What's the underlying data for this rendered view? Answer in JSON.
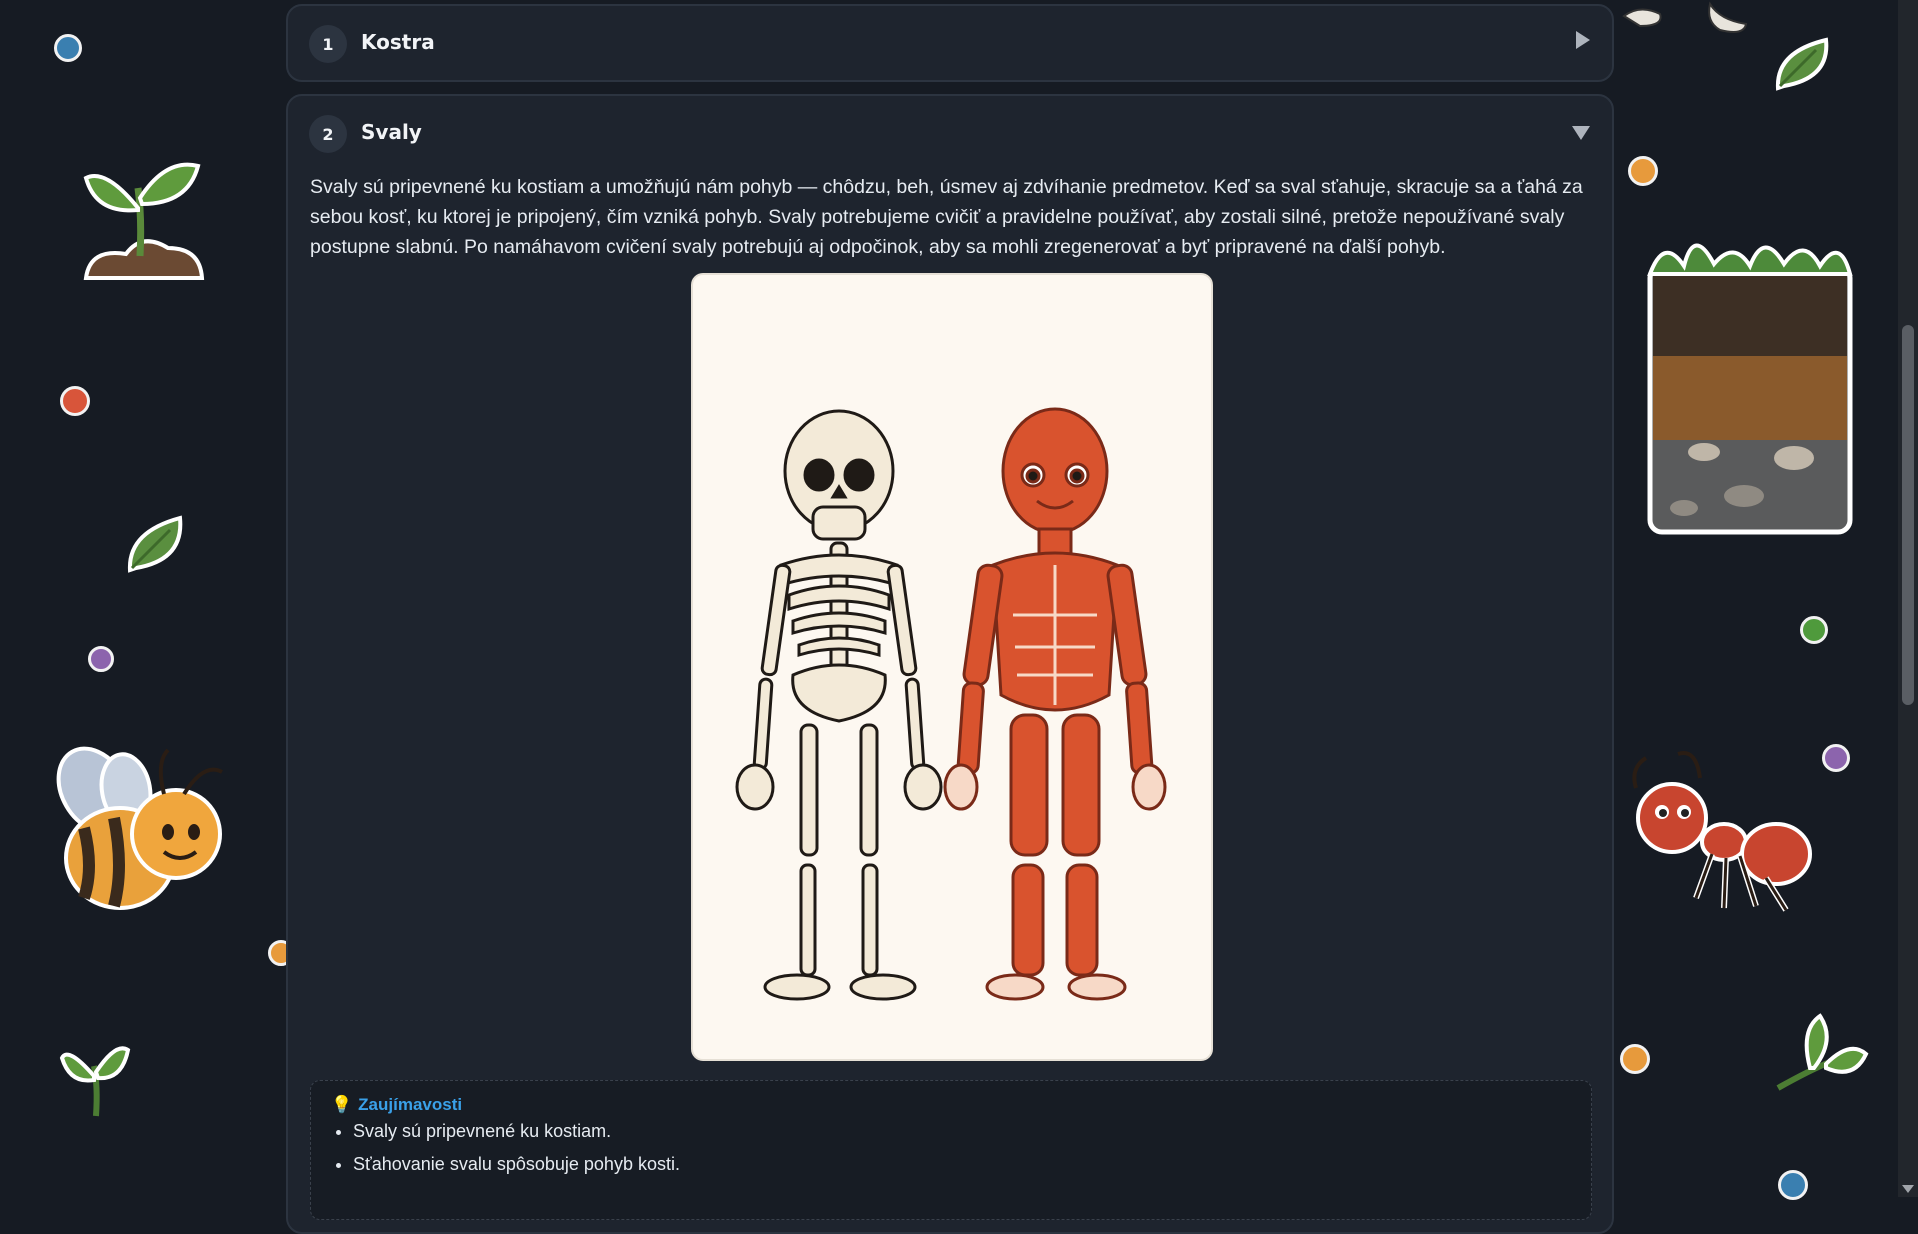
{
  "sections": [
    {
      "number": "1",
      "title": "Kostra",
      "expanded": false
    },
    {
      "number": "2",
      "title": "Svaly",
      "expanded": true,
      "paragraph": "Svaly sú pripevnené ku kostiam a umožňujú nám pohyb — chôdzu, beh, úsmev aj zdvíhanie predmetov. Keď sa sval sťahuje, skracuje sa a ťahá za sebou kosť, ku ktorej je pripojený, čím vzniká pohyb. Svaly potrebujeme cvičiť a pravidelne používať, aby zostali silné, pretože nepoužívané svaly postupne slabnú. Po namáhavom cvičení svaly potrebujú aj odpočinok, aby sa mohli zregenerovať a byť pripravené na ďalší pohyb.",
      "facts": {
        "icon": "lightbulb-icon",
        "heading": "Zaujímavosti",
        "items": [
          "Svaly sú pripevnené ku kostiam.",
          "Sťahovanie svalu spôsobuje pohyb kosti."
        ]
      }
    }
  ],
  "colors": {
    "background": "#161b23",
    "card": "#1e242e",
    "accent": "#3aa0e8",
    "muscle": "#d9532e",
    "bone": "#f3ead8"
  },
  "decorations": [
    "sprout-icon",
    "leaf-icon",
    "bee-icon",
    "soil-layers-icon",
    "ant-icon",
    "feet-icon"
  ]
}
